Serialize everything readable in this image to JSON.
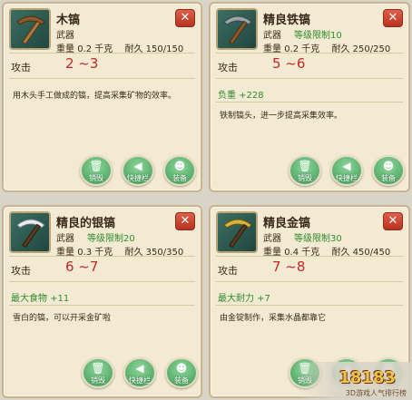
{
  "common": {
    "close": "✕",
    "attack_label": "攻击",
    "weight_label": "重量",
    "durability_label": "耐久"
  },
  "buttons": {
    "discard": "销毁",
    "quickbar": "快捷栏",
    "equip": "装备"
  },
  "cards": [
    {
      "name": "木镐",
      "type": "武器",
      "level_req": "",
      "weight": "0.2 千克",
      "durability": "150/150",
      "attack": "2 ~3",
      "bonus": "",
      "desc": "用木头手工做成的镐，提高采集矿物的效率。"
    },
    {
      "name": "精良铁镐",
      "type": "武器",
      "level_req": "等级限制10",
      "weight": "0.2 千克",
      "durability": "250/250",
      "attack": "5 ~6",
      "bonus": "负重 +228",
      "desc": "铁制镐头，进一步提高采集效率。"
    },
    {
      "name": "精良的银镐",
      "type": "武器",
      "level_req": "等级限制20",
      "weight": "0.3 千克",
      "durability": "350/350",
      "attack": "6 ~7",
      "bonus": "最大食物 +11",
      "desc": "雪白的镐，可以开采金矿啦"
    },
    {
      "name": "精良金镐",
      "type": "武器",
      "level_req": "等级限制30",
      "weight": "0.4 千克",
      "durability": "450/450",
      "attack": "7 ~8",
      "bonus": "最大耐力 +7",
      "desc": "由金锭制作，采集水晶都靠它"
    }
  ],
  "watermark": {
    "logo": "18183",
    "sub": "3D游戏人气排行榜"
  },
  "colors": {
    "card_bg": "#f3ead3",
    "card_border": "#c9b48b",
    "attack": "#c0282a",
    "bonus": "#2e8b2e",
    "button": "#3f9c58",
    "close": "#c33b25"
  },
  "icons": {
    "card_0": "wooden-pickaxe-icon",
    "card_1": "iron-pickaxe-icon",
    "card_2": "silver-pickaxe-icon",
    "card_3": "gold-pickaxe-icon",
    "discard": "trash-icon",
    "quickbar": "arrow-icon",
    "equip": "person-icon"
  }
}
